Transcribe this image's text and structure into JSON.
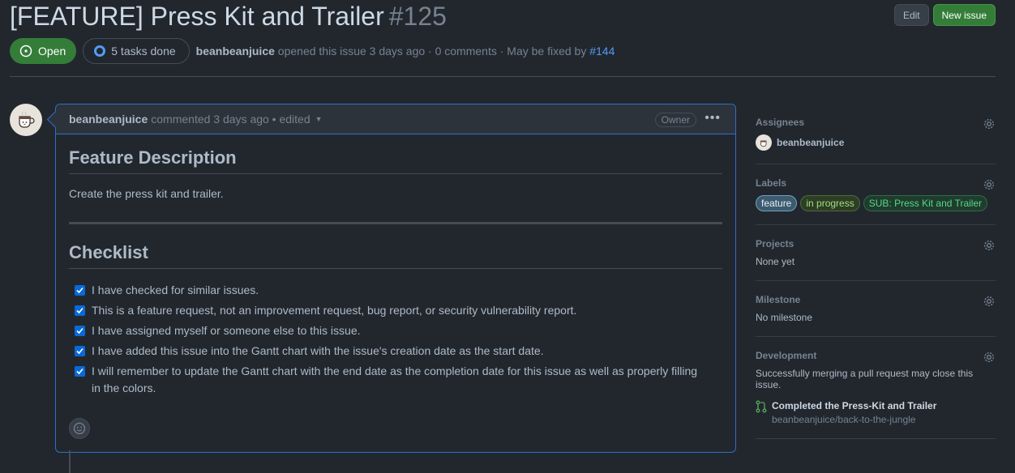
{
  "issue": {
    "title": "[FEATURE] Press Kit and Trailer",
    "number": "#125",
    "state": "Open",
    "tasks": "5 tasks done",
    "author": "beanbeanjuice",
    "opened_text": " opened this issue 3 days ago · 0 comments · May be fixed by ",
    "fixed_by": "#144"
  },
  "header_buttons": {
    "edit": "Edit",
    "new_issue": "New issue"
  },
  "comment": {
    "author": "beanbeanjuice",
    "meta": "commented 3 days ago • edited",
    "owner_badge": "Owner",
    "more": "•••",
    "description_heading": "Feature Description",
    "description": "Create the press kit and trailer.",
    "checklist_heading": "Checklist",
    "checklist": [
      "I have checked for similar issues.",
      "This is a feature request, not an improvement request, bug report, or security vulnerability report.",
      "I have assigned myself or someone else to this issue.",
      "I have added this issue into the Gantt chart with the issue's creation date as the start date.",
      "I will remember to update the Gantt chart with the end date as the completion date for this issue as well as properly filling in the colors."
    ]
  },
  "sidebar": {
    "assignees": {
      "title": "Assignees",
      "name": "beanbeanjuice"
    },
    "labels": {
      "title": "Labels",
      "items": [
        "feature",
        "in progress",
        "SUB: Press Kit and Trailer"
      ]
    },
    "projects": {
      "title": "Projects",
      "value": "None yet"
    },
    "milestone": {
      "title": "Milestone",
      "value": "No milestone"
    },
    "development": {
      "title": "Development",
      "text": "Successfully merging a pull request may close this issue.",
      "pr_title": "Completed the Press-Kit and Trailer",
      "pr_repo": "beanbeanjuice/back-to-the-jungle"
    }
  },
  "colors": {
    "open": "#347d39",
    "link": "#539bf5",
    "accent_border": "#316dca"
  }
}
